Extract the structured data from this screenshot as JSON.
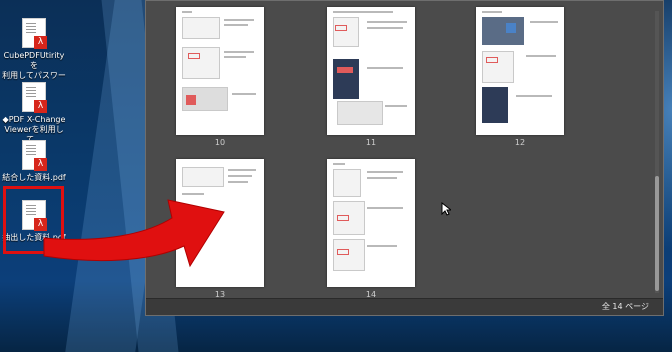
{
  "desktop": {
    "icons": [
      {
        "label": "CubePDFUtirityを\n利用してパスワード..."
      },
      {
        "label": "◆PDF X-Change\nViewerを利用して..."
      },
      {
        "label": "結合した資料.pdf"
      },
      {
        "label": "抽出した資料.pdf"
      }
    ]
  },
  "viewer": {
    "pages": [
      "10",
      "11",
      "12",
      "13",
      "14"
    ],
    "total": "全 14 ページ"
  },
  "colors": {
    "highlight": "#e01010",
    "arrow": "#e01010",
    "viewer_bg": "#4b4b4b"
  }
}
